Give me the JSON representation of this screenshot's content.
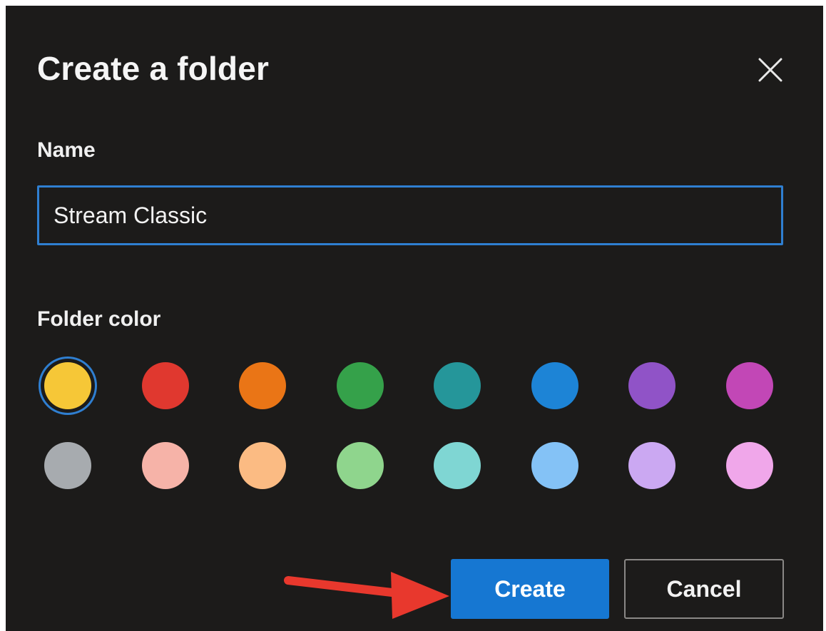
{
  "dialog": {
    "title": "Create a folder",
    "close_icon": "close-icon"
  },
  "name_field": {
    "label": "Name",
    "value": "Stream Classic",
    "placeholder": ""
  },
  "folder_color": {
    "label": "Folder color",
    "selected": "yellow",
    "options": [
      {
        "name": "yellow",
        "hex": "#f6c737"
      },
      {
        "name": "red",
        "hex": "#e0382f"
      },
      {
        "name": "orange",
        "hex": "#ea7516"
      },
      {
        "name": "green",
        "hex": "#35a14a"
      },
      {
        "name": "teal",
        "hex": "#25969a"
      },
      {
        "name": "blue",
        "hex": "#1d84d6"
      },
      {
        "name": "purple",
        "hex": "#9053c7"
      },
      {
        "name": "magenta",
        "hex": "#c247b6"
      },
      {
        "name": "gray",
        "hex": "#a7abaf"
      },
      {
        "name": "light-red",
        "hex": "#f6b3a8"
      },
      {
        "name": "light-orange",
        "hex": "#fbbb83"
      },
      {
        "name": "light-green",
        "hex": "#8fd58d"
      },
      {
        "name": "light-teal",
        "hex": "#7fd6d3"
      },
      {
        "name": "light-blue",
        "hex": "#84c2f6"
      },
      {
        "name": "light-purple",
        "hex": "#cba8f2"
      },
      {
        "name": "light-magenta",
        "hex": "#f0a7ea"
      }
    ]
  },
  "actions": {
    "create_label": "Create",
    "cancel_label": "Cancel"
  },
  "annotation": {
    "arrow_color": "#e8382d"
  },
  "colors": {
    "background": "#1c1b1a",
    "accent": "#1677d2",
    "focus_border": "#2f7fd1"
  }
}
